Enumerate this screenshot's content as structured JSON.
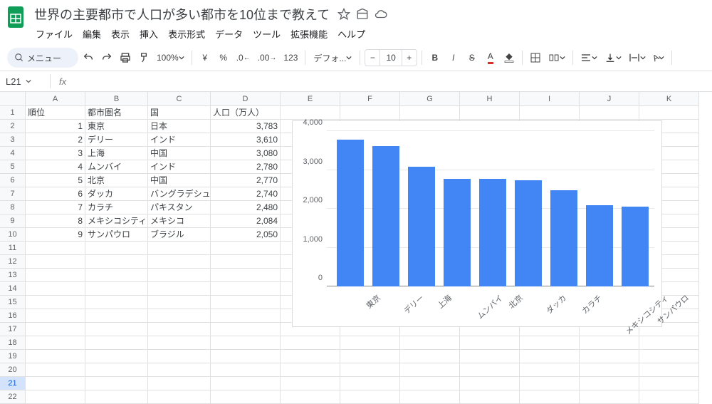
{
  "doc": {
    "title": "世界の主要都市で人口が多い都市を10位まで教えて"
  },
  "menu": [
    "ファイル",
    "編集",
    "表示",
    "挿入",
    "表示形式",
    "データ",
    "ツール",
    "拡張機能",
    "ヘルプ"
  ],
  "toolbar": {
    "search_label": "メニュー",
    "zoom": "100%",
    "currency": "¥",
    "percent": "%",
    "font": "デフォ...",
    "fontsize": "10"
  },
  "namebox": {
    "cell": "L21"
  },
  "columns": [
    "A",
    "B",
    "C",
    "D",
    "E",
    "F",
    "G",
    "H",
    "I",
    "J",
    "K"
  ],
  "row_count": 22,
  "selected_row": 21,
  "table": {
    "headers": [
      "順位",
      "都市圏名",
      "国",
      "人口（万人）"
    ],
    "rows": [
      [
        1,
        "東京",
        "日本",
        "3,783"
      ],
      [
        2,
        "デリー",
        "インド",
        "3,610"
      ],
      [
        3,
        "上海",
        "中国",
        "3,080"
      ],
      [
        4,
        "ムンバイ",
        "インド",
        "2,780"
      ],
      [
        5,
        "北京",
        "中国",
        "2,770"
      ],
      [
        6,
        "ダッカ",
        "バングラデシュ",
        "2,740"
      ],
      [
        7,
        "カラチ",
        "パキスタン",
        "2,480"
      ],
      [
        8,
        "メキシコシティ",
        "メキシコ",
        "2,084"
      ],
      [
        9,
        "サンパウロ",
        "ブラジル",
        "2,050"
      ]
    ]
  },
  "chart_data": {
    "type": "bar",
    "categories": [
      "東京",
      "デリー",
      "上海",
      "ムンバイ",
      "北京",
      "ダッカ",
      "カラチ",
      "メキシコシティ",
      "サンパウロ"
    ],
    "values": [
      3783,
      3610,
      3080,
      2780,
      2770,
      2740,
      2480,
      2084,
      2050
    ],
    "ylim": [
      0,
      4000
    ],
    "yticks": [
      0,
      1000,
      2000,
      3000,
      4000
    ],
    "ytick_labels": [
      "0",
      "1,000",
      "2,000",
      "3,000",
      "4,000"
    ],
    "color": "#4285f4"
  }
}
